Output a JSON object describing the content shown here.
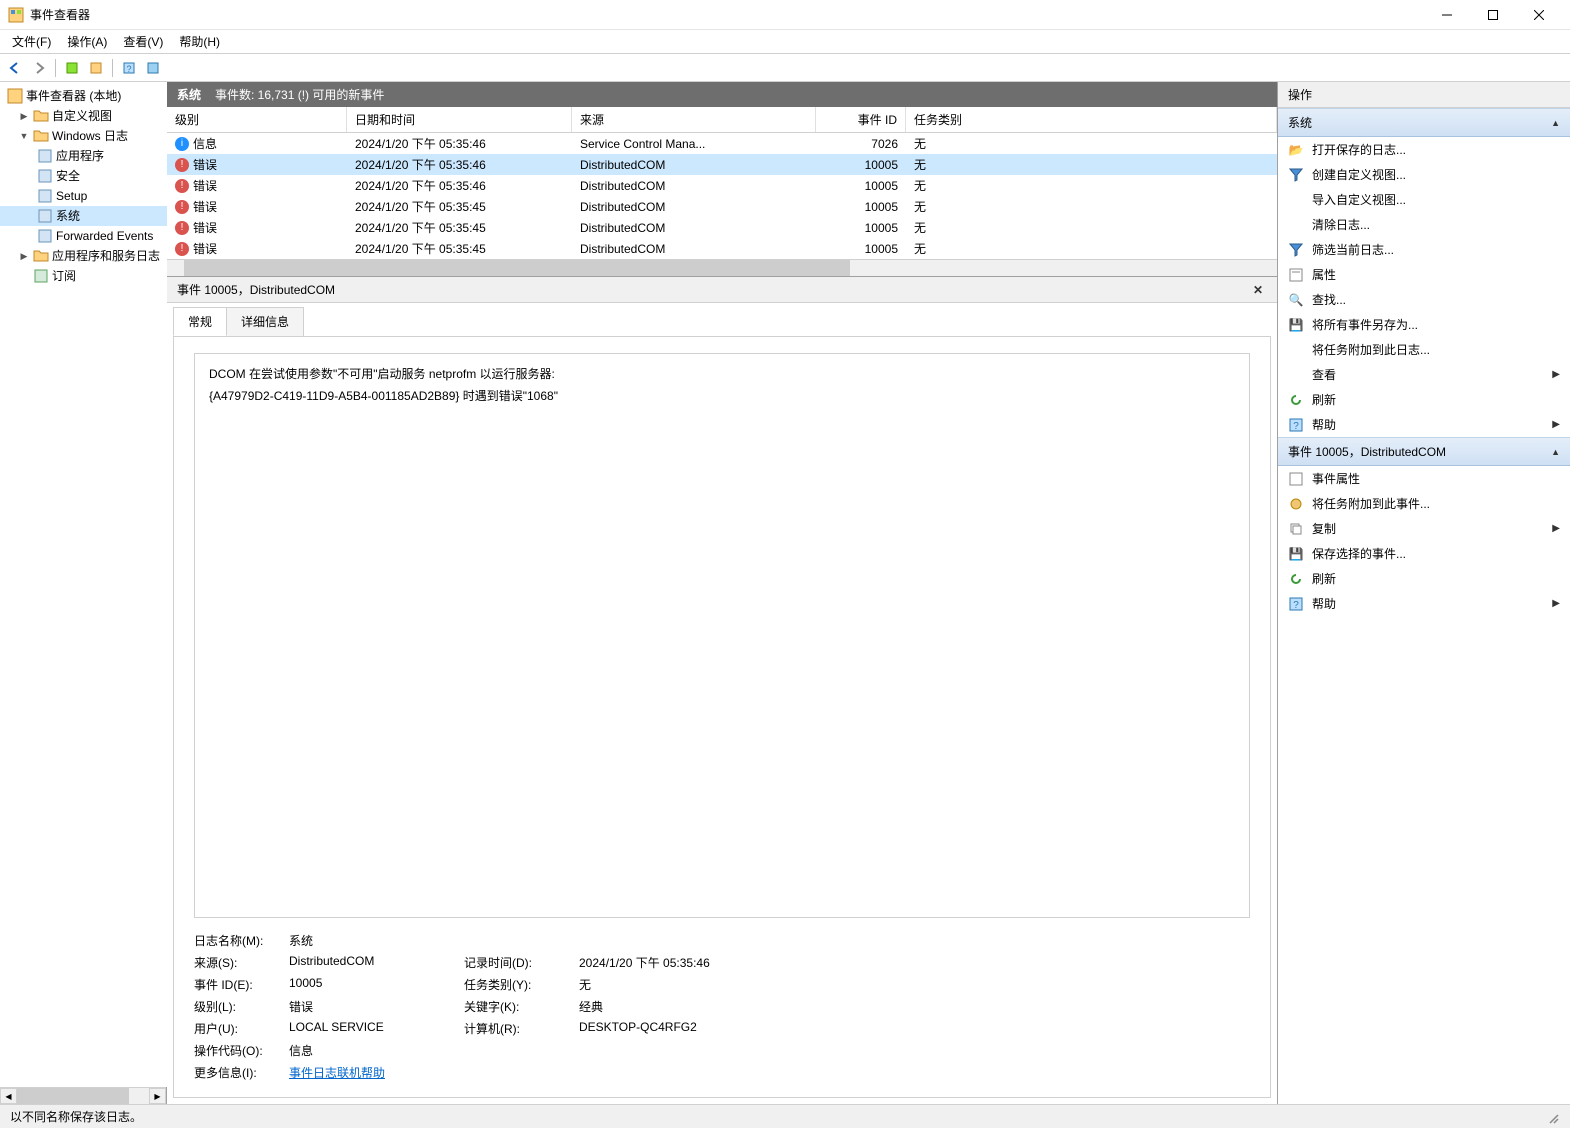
{
  "window": {
    "title": "事件查看器"
  },
  "menu": {
    "file": "文件(F)",
    "action": "操作(A)",
    "view": "查看(V)",
    "help": "帮助(H)"
  },
  "tree": {
    "root": "事件查看器 (本地)",
    "customViews": "自定义视图",
    "windowsLogs": "Windows 日志",
    "application": "应用程序",
    "security": "安全",
    "setup": "Setup",
    "system": "系统",
    "forwarded": "Forwarded Events",
    "appServices": "应用程序和服务日志",
    "subscriptions": "订阅"
  },
  "listHeader": {
    "title": "系统",
    "count": "事件数: 16,731 (!) 可用的新事件"
  },
  "columns": {
    "level": "级别",
    "datetime": "日期和时间",
    "source": "来源",
    "eventId": "事件 ID",
    "task": "任务类别"
  },
  "events": [
    {
      "type": "info",
      "level": "信息",
      "datetime": "2024/1/20 下午 05:35:46",
      "source": "Service Control Mana...",
      "id": "7026",
      "task": "无"
    },
    {
      "type": "error",
      "level": "错误",
      "datetime": "2024/1/20 下午 05:35:46",
      "source": "DistributedCOM",
      "id": "10005",
      "task": "无",
      "selected": true
    },
    {
      "type": "error",
      "level": "错误",
      "datetime": "2024/1/20 下午 05:35:46",
      "source": "DistributedCOM",
      "id": "10005",
      "task": "无"
    },
    {
      "type": "error",
      "level": "错误",
      "datetime": "2024/1/20 下午 05:35:45",
      "source": "DistributedCOM",
      "id": "10005",
      "task": "无"
    },
    {
      "type": "error",
      "level": "错误",
      "datetime": "2024/1/20 下午 05:35:45",
      "source": "DistributedCOM",
      "id": "10005",
      "task": "无"
    },
    {
      "type": "error",
      "level": "错误",
      "datetime": "2024/1/20 下午 05:35:45",
      "source": "DistributedCOM",
      "id": "10005",
      "task": "无"
    }
  ],
  "detail": {
    "title": "事件 10005，DistributedCOM",
    "tabGeneral": "常规",
    "tabDetails": "详细信息",
    "msgLine1": "DCOM 在尝试使用参数\"不可用\"启动服务 netprofm 以运行服务器:",
    "msgLine2": "{A47979D2-C419-11D9-A5B4-001185AD2B89} 时遇到错误\"1068\"",
    "labels": {
      "logName": "日志名称(M):",
      "source": "来源(S):",
      "eventId": "事件 ID(E):",
      "level": "级别(L):",
      "user": "用户(U):",
      "opcode": "操作代码(O):",
      "moreInfo": "更多信息(I):",
      "logged": "记录时间(D):",
      "taskCat": "任务类别(Y):",
      "keywords": "关键字(K):",
      "computer": "计算机(R):"
    },
    "values": {
      "logName": "系统",
      "source": "DistributedCOM",
      "eventId": "10005",
      "level": "错误",
      "user": "LOCAL SERVICE",
      "opcode": "信息",
      "moreInfoLink": "事件日志联机帮助",
      "logged": "2024/1/20 下午 05:35:46",
      "taskCat": "无",
      "keywords": "经典",
      "computer": "DESKTOP-QC4RFG2"
    }
  },
  "actions": {
    "title": "操作",
    "group1": "系统",
    "group1Items": {
      "openSaved": "打开保存的日志...",
      "createCustom": "创建自定义视图...",
      "importCustom": "导入自定义视图...",
      "clearLog": "清除日志...",
      "filterCurrent": "筛选当前日志...",
      "properties": "属性",
      "find": "查找...",
      "saveAll": "将所有事件另存为...",
      "attachTask": "将任务附加到此日志...",
      "view": "查看",
      "refresh": "刷新",
      "help": "帮助"
    },
    "group2": "事件 10005，DistributedCOM",
    "group2Items": {
      "eventProps": "事件属性",
      "attachToEvent": "将任务附加到此事件...",
      "copy": "复制",
      "saveSelected": "保存选择的事件...",
      "refresh": "刷新",
      "help": "帮助"
    }
  },
  "statusbar": "以不同名称保存该日志。"
}
